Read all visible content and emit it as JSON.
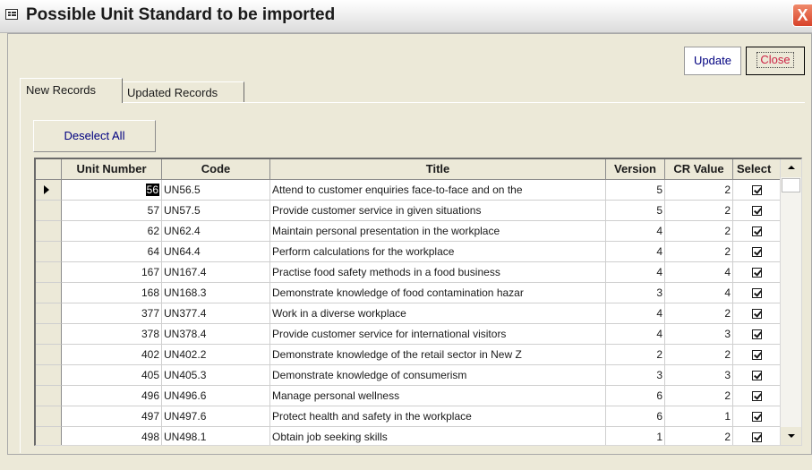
{
  "window": {
    "title": "Possible Unit Standard to be imported",
    "close_glyph": "X"
  },
  "toolbar": {
    "update_label": "Update",
    "close_label": "Close"
  },
  "tabs": [
    {
      "label": "New Records",
      "active": true
    },
    {
      "label": "Updated Records",
      "active": false
    }
  ],
  "deselect_label": "Deselect All",
  "table": {
    "columns": [
      "Unit Number",
      "Code",
      "Title",
      "Version",
      "CR Value",
      "Select"
    ],
    "rows": [
      {
        "unit": "56",
        "code": "UN56.5",
        "title": "Attend to customer enquiries face-to-face and on the",
        "version": "5",
        "cr": "2",
        "selected": true,
        "current": true
      },
      {
        "unit": "57",
        "code": "UN57.5",
        "title": "Provide customer service in given situations",
        "version": "5",
        "cr": "2",
        "selected": true
      },
      {
        "unit": "62",
        "code": "UN62.4",
        "title": "Maintain personal presentation in the workplace",
        "version": "4",
        "cr": "2",
        "selected": true
      },
      {
        "unit": "64",
        "code": "UN64.4",
        "title": "Perform calculations for the workplace",
        "version": "4",
        "cr": "2",
        "selected": true
      },
      {
        "unit": "167",
        "code": "UN167.4",
        "title": "Practise food safety methods in a food business",
        "version": "4",
        "cr": "4",
        "selected": true
      },
      {
        "unit": "168",
        "code": "UN168.3",
        "title": "Demonstrate knowledge of food contamination hazar",
        "version": "3",
        "cr": "4",
        "selected": true
      },
      {
        "unit": "377",
        "code": "UN377.4",
        "title": "Work in a diverse workplace",
        "version": "4",
        "cr": "2",
        "selected": true
      },
      {
        "unit": "378",
        "code": "UN378.4",
        "title": "Provide customer service for international visitors",
        "version": "4",
        "cr": "3",
        "selected": true
      },
      {
        "unit": "402",
        "code": "UN402.2",
        "title": "Demonstrate knowledge of the retail sector in New Z",
        "version": "2",
        "cr": "2",
        "selected": true
      },
      {
        "unit": "405",
        "code": "UN405.3",
        "title": "Demonstrate knowledge of consumerism",
        "version": "3",
        "cr": "3",
        "selected": true
      },
      {
        "unit": "496",
        "code": "UN496.6",
        "title": "Manage personal wellness",
        "version": "6",
        "cr": "2",
        "selected": true
      },
      {
        "unit": "497",
        "code": "UN497.6",
        "title": "Protect health and safety in the workplace",
        "version": "6",
        "cr": "1",
        "selected": true
      },
      {
        "unit": "498",
        "code": "UN498.1",
        "title": "Obtain job seeking skills",
        "version": "1",
        "cr": "2",
        "selected": true
      }
    ]
  },
  "icons": {
    "window": "form-icon",
    "record_selector": "current-record-arrow-icon",
    "checkbox": "checkbox-checked-icon",
    "scroll_up": "scroll-up-arrow-icon",
    "scroll_down": "scroll-down-arrow-icon"
  }
}
